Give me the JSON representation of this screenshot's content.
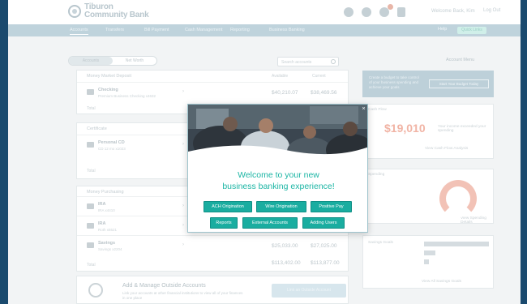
{
  "bank": {
    "name_line1": "Tiburon",
    "name_line2": "Community Bank"
  },
  "header": {
    "user": "Welcome Back, Kim",
    "signout": "Log Out",
    "notifications": 3
  },
  "nav": {
    "items": [
      "Accounts",
      "Transfers",
      "Bill Payment",
      "Cash Management",
      "Reporting",
      "Business Banking"
    ],
    "help": "Help",
    "pill": "Quick Links"
  },
  "accounts": {
    "view_tabs": [
      "Accounts",
      "Net Worth"
    ],
    "search_placeholder": "Search accounts",
    "col_available": "Available",
    "col_current": "Current",
    "groups": [
      {
        "title": "Money Market Deposit",
        "rows": [
          {
            "name": "Checking",
            "sub": "Premium Business Checking x4632",
            "available": "$40,210.07",
            "current": "$38,469.56"
          }
        ],
        "total": "Total"
      },
      {
        "title": "Certificate",
        "rows": [
          {
            "name": "Personal CD",
            "sub": "CD 12 mo x1023"
          }
        ],
        "total": "Total"
      },
      {
        "title": "Money Purchasing",
        "rows": [
          {
            "name": "IRA",
            "sub": "IRA x4410"
          },
          {
            "name": "IRA",
            "sub": "Roth x5521"
          },
          {
            "name": "Savings",
            "sub": "Savings x2204",
            "available": "$25,033.00",
            "current": "$27,025.00"
          }
        ],
        "total": "Total",
        "total_available": "$113,402.00",
        "total_current": "$113,877.00"
      }
    ]
  },
  "manage": {
    "title": "Add & Manage Outside Accounts",
    "desc": "Link your accounts at other financial institutions to view all of your finances in one place",
    "button": "Link an Outside Account"
  },
  "right": {
    "link": "Account Menu",
    "promo_text": "Create a budget to take control of your business spending and achieve your goals",
    "promo_button": "Start Your Budget Today",
    "cashflow_title": "Cash Flow",
    "cashflow_amount": "$19,010",
    "cashflow_note": "Your income exceeded your spending",
    "cashflow_link": "View Cash Flow Analysis",
    "spending_title": "Spending",
    "spending_link": "View Spending Details",
    "goals_title": "Savings Goals",
    "goals_link": "View All Savings Goals"
  },
  "modal": {
    "title_line1": "Welcome to your new",
    "title_line2": "business banking experience!",
    "close": "×",
    "buttons": [
      "ACH Origination",
      "Wire Origination",
      "Positive Pay",
      "Reports",
      "External Accounts",
      "Adding Users"
    ]
  },
  "colors": {
    "accent": "#1aada0",
    "brand": "#1a4a6e",
    "nav": "#bfd3dc"
  }
}
